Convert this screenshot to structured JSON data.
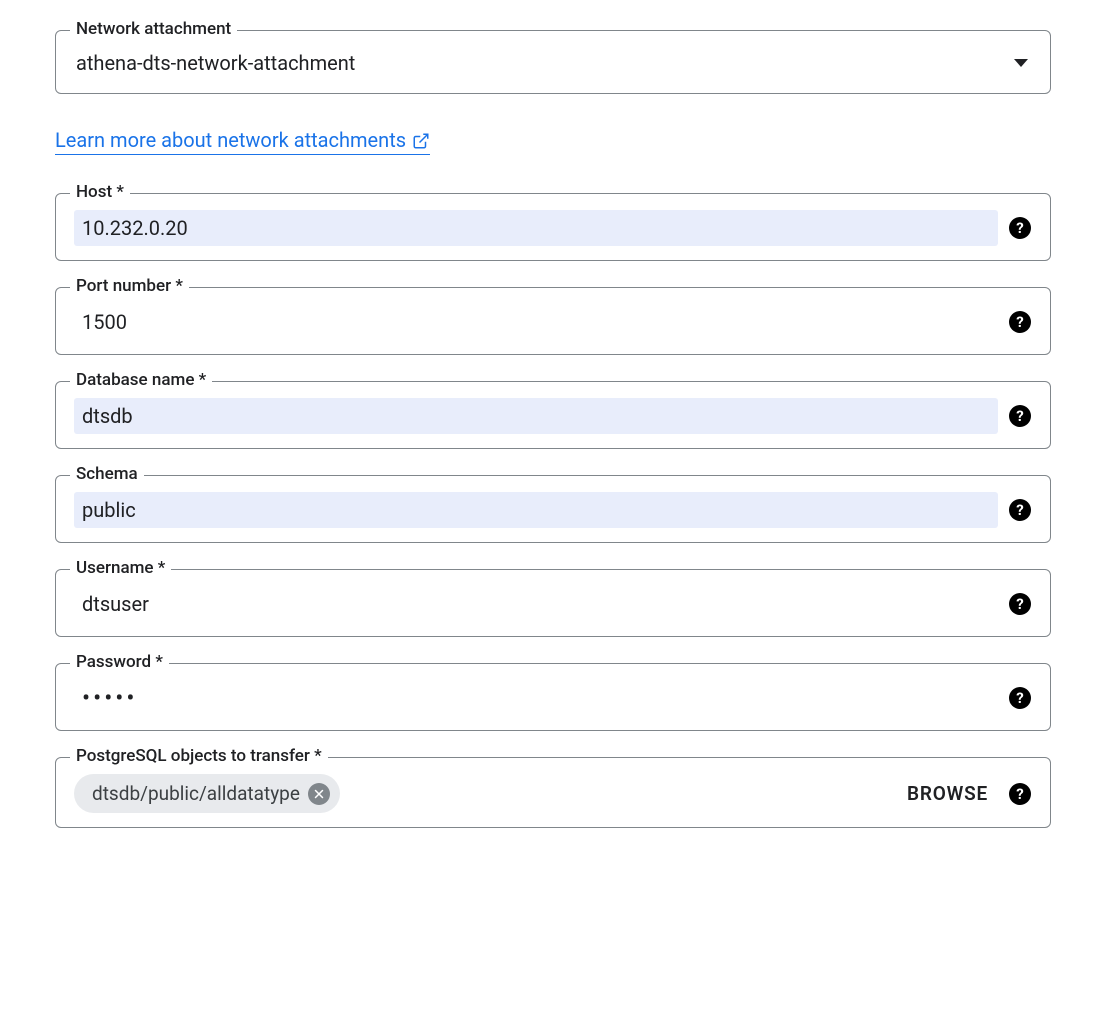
{
  "network_attachment": {
    "label": "Network attachment",
    "value": "athena-dts-network-attachment"
  },
  "learn_more_link": "Learn more about network attachments",
  "fields": {
    "host": {
      "label": "Host *",
      "value": "10.232.0.20"
    },
    "port": {
      "label": "Port number *",
      "value": "1500"
    },
    "database": {
      "label": "Database name *",
      "value": "dtsdb"
    },
    "schema": {
      "label": "Schema",
      "value": "public"
    },
    "username": {
      "label": "Username *",
      "value": "dtsuser"
    },
    "password": {
      "label": "Password *",
      "value": "•••••"
    },
    "objects": {
      "label": "PostgreSQL objects to transfer *",
      "chip": "dtsdb/public/alldatatype",
      "browse": "BROWSE"
    }
  }
}
